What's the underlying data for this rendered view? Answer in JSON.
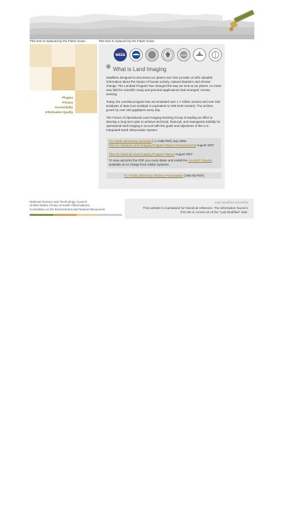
{
  "header": {
    "flash_note_left": "This text is replaced by the Flash movie.",
    "flash_note_right": "This text is replaced by the Flash movie."
  },
  "left_nav": {
    "items": [
      {
        "label": "Plugins"
      },
      {
        "label": "Privacy"
      },
      {
        "label": "Accessibility"
      },
      {
        "label": "Information Quality"
      }
    ]
  },
  "agencies": {
    "icons": [
      "nasa-logo-icon",
      "noaa-seal-icon",
      "usgs-seal-icon",
      "dod-seal-icon",
      "interior-seal-icon",
      "agriculture-seal-icon",
      "usgs-globe-icon"
    ]
  },
  "main": {
    "title": "What is Land Imaging",
    "para1": "Satellites designed to document our planet over time provide us with valuable information about the impact of human activity, natural disasters and climate change. The Landsat Program has changed the way we look at our planet. An entire new field for scientific study and practical applications had emerged: remote sensing.",
    "para2": "Today, the Landsat program has accumulated over 1.7 million scenes and over 630 terabytes of data (one terabyte is equivalent to 109 DVD movies). The archive grows by over 320 gigabytes every day.",
    "para3": "The Future of Operational Land Imaging Working Group is leading an effort to develop a long-term plan to achieve technical, financial, and managerial stability for operational land imaging in accord with the goals and objectives of the U.S. Integrated Earth Observation System.",
    "links": {
      "summary_link": "FLI Public Workshop Summary",
      "summary_meta": "[ 1.4 MB PDF] July 2006",
      "announcement_link": "Plan for National Land Imaging Program Report Announcement",
      "announcement_date": "August 2007",
      "report_link": "Plan for National Land Imaging Program Report",
      "report_date": "August 2007",
      "acrobat_pre": "To view and print the PDF you must obtain and install the",
      "acrobat_link": "Acrobat® Reader",
      "acrobat_post": ", available at no charge from Adobe Systems."
    },
    "whitney_link": "FLI Public Workshop Whitney Presentation",
    "whitney_meta": "[ 596 KB PDF]"
  },
  "footer": {
    "org1": "National Science and Technology Council",
    "org2": "United States Group on Earth Observations",
    "org3": "Committee on the Environment and Natural Resources",
    "last_modified": "Last Modified 04/29/08",
    "note_line1": "This website is maintained for historical reference.  The information found in",
    "note_line2": "this site is current as of the \"Last Modified\" date."
  },
  "colors": {
    "accent_gold": "#9b7e2f",
    "tile_light": "#f1e2c2",
    "tile_mid": "#e6c894",
    "tile_dark": "#dcb877",
    "bar_olive": "#8c9550",
    "bar_gold": "#d8a85a",
    "bar_tan": "#e9cf9f",
    "bar_grey": "#cfcfcf"
  }
}
